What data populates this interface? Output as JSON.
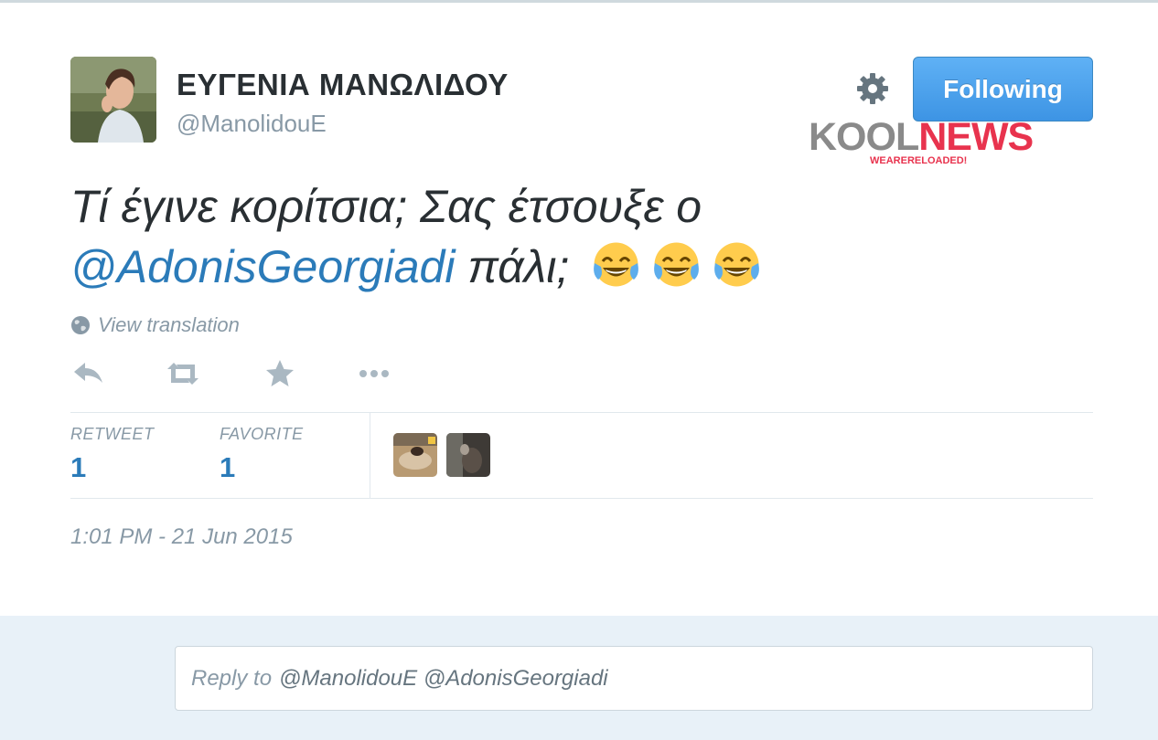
{
  "user": {
    "display_name": "ΕΥΓΕΝΙΑ ΜΑΝΩΛΙΔΟΥ",
    "handle": "@ManolidouE"
  },
  "header": {
    "follow_button_label": "Following",
    "settings_icon": "gear-icon"
  },
  "watermark": {
    "logo_part1": "KOOL",
    "logo_part2": "NEWS",
    "tagline": "WEARERELOADED!"
  },
  "tweet": {
    "text_line1": "Τί έγινε κορίτσια; Σας έτσουξε ο",
    "mention": "@AdonisGeorgiadi",
    "text_line2_rest": "πάλι;",
    "emojis": [
      "face-with-tears-of-joy",
      "face-with-tears-of-joy",
      "face-with-tears-of-joy"
    ],
    "view_translation": "View translation"
  },
  "actions": {
    "icons": [
      "reply-icon",
      "retweet-icon",
      "favorite-star-icon",
      "more-dots-icon"
    ]
  },
  "stats": {
    "retweet_label": "RETWEET",
    "retweet_count": "1",
    "favorite_label": "FAVORITE",
    "favorite_count": "1"
  },
  "timestamp": "1:01 PM - 21 Jun 2015",
  "reply": {
    "prefix": "Reply to",
    "recipients": "@ManolidouE @AdonisGeorgiadi"
  },
  "colors": {
    "link": "#2b7bb9",
    "follow_button": "#4aa3ef",
    "muted_text": "#8899a6",
    "reply_background": "#e8f1f8",
    "watermark_red": "#e8334e"
  }
}
